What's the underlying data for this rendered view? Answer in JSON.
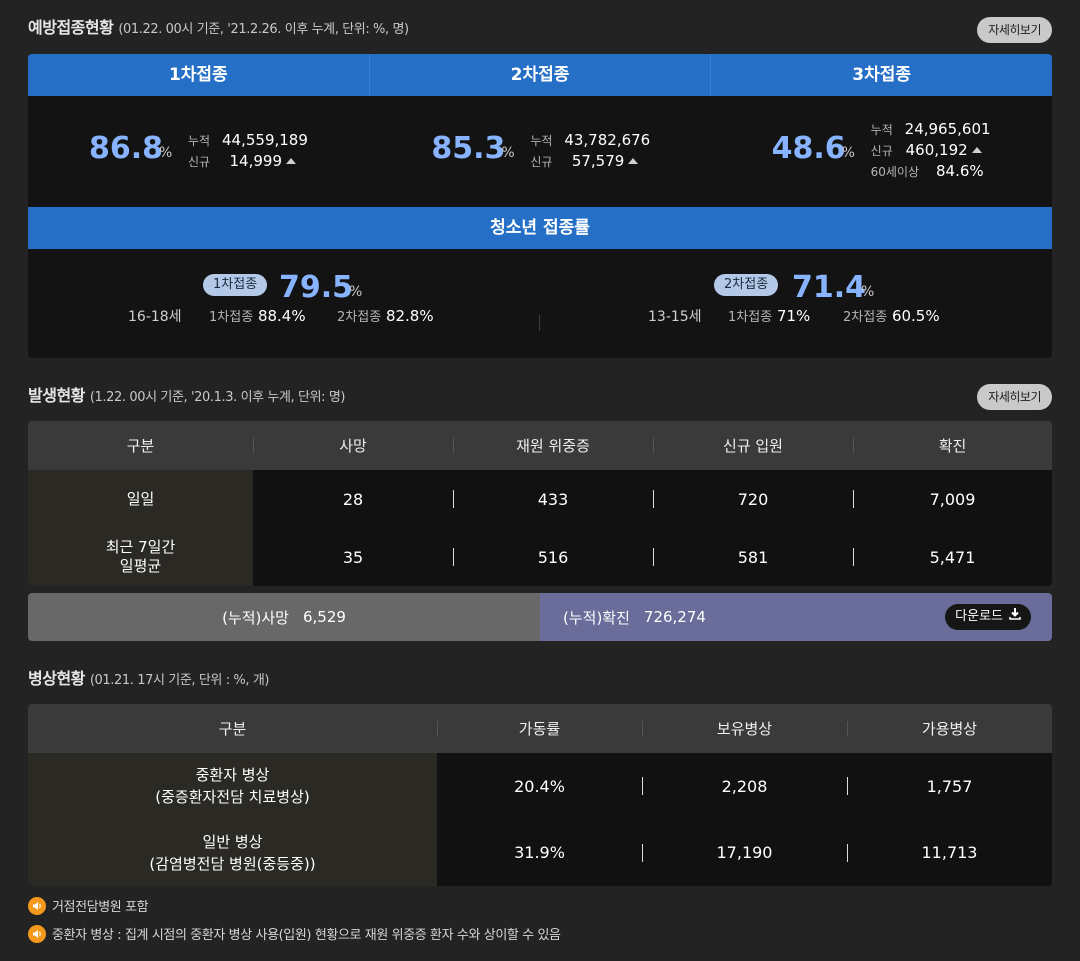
{
  "vaccination": {
    "title": "예방접종현황",
    "subtitle": "(01.22. 00시 기준, '21.2.26. 이후 누계, 단위: %, 명)",
    "more": "자세히보기",
    "columns": [
      {
        "head": "1차접종",
        "rate": "86.8",
        "unit": "%",
        "cum_label": "누적",
        "cum": "44,559,189",
        "new_label": "신규",
        "new": "14,999"
      },
      {
        "head": "2차접종",
        "rate": "85.3",
        "unit": "%",
        "cum_label": "누적",
        "cum": "43,782,676",
        "new_label": "신규",
        "new": "57,579"
      },
      {
        "head": "3차접종",
        "rate": "48.6",
        "unit": "%",
        "cum_label": "누적",
        "cum": "24,965,601",
        "new_label": "신규",
        "new": "460,192",
        "age_label": "60세이상",
        "age": "84.6%"
      }
    ],
    "youth": {
      "title": "청소년 접종률",
      "groups": [
        {
          "age": "16-18세",
          "badge": "1차접종",
          "rate": "79.5",
          "unit": "%",
          "d1_label": "1차접종",
          "d1": "88.4%",
          "d2_label": "2차접종",
          "d2": "82.8%"
        },
        {
          "age": "13-15세",
          "badge": "2차접종",
          "rate": "71.4",
          "unit": "%",
          "d1_label": "1차접종",
          "d1": "71%",
          "d2_label": "2차접종",
          "d2": "60.5%"
        }
      ]
    }
  },
  "outbreak": {
    "title": "발생현황",
    "subtitle": "(1.22. 00시 기준, '20.1.3. 이후 누계, 단위: 명)",
    "more": "자세히보기",
    "headers": [
      "구분",
      "사망",
      "재원 위중증",
      "신규 입원",
      "확진"
    ],
    "rows": [
      {
        "label": "일일",
        "values": [
          "28",
          "433",
          "720",
          "7,009"
        ]
      },
      {
        "label": "최근 7일간\n일평균",
        "values": [
          "35",
          "516",
          "581",
          "5,471"
        ]
      }
    ],
    "cum_death_label": "(누적)사망",
    "cum_death": "6,529",
    "cum_confirmed_label": "(누적)확진",
    "cum_confirmed": "726,274",
    "download": "다운로드"
  },
  "beds": {
    "title": "병상현황",
    "subtitle": "(01.21. 17시 기준, 단위 : %, 개)",
    "headers": [
      "구분",
      "가동률",
      "보유병상",
      "가용병상"
    ],
    "rows": [
      {
        "label": "중환자 병상\n(중증환자전담 치료병상)",
        "values": [
          "20.4%",
          "2,208",
          "1,757"
        ]
      },
      {
        "label": "일반 병상\n(감염병전담 병원(중등중))",
        "values": [
          "31.9%",
          "17,190",
          "11,713"
        ]
      }
    ]
  },
  "notes": [
    "거점전담병원 포함",
    "중환자 병상 : 집계 시점의 중환자 병상 사용(입원) 현황으로 재원 위중증 환자 수와 상이할 수 있음"
  ],
  "colors": {
    "accent_blue": "#2570c6",
    "rate_blue": "#87b3ff",
    "cum_purple": "#6a6d9a",
    "note_orange": "#f39a1d"
  }
}
